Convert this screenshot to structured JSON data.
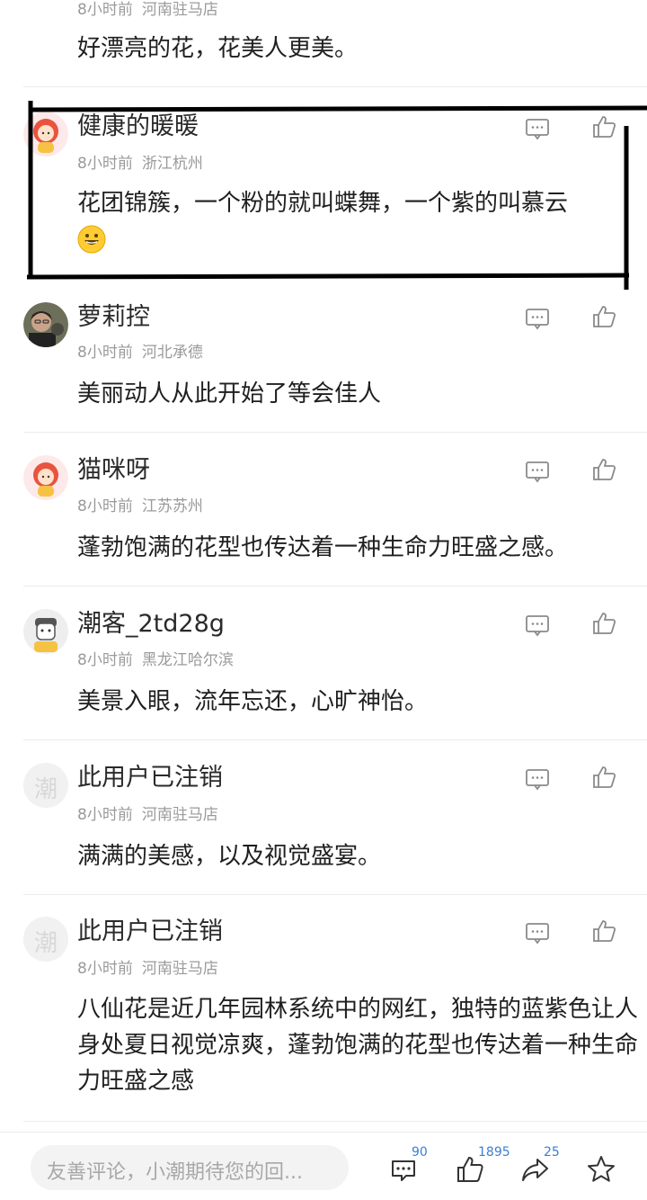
{
  "comments": [
    {
      "username": "",
      "time": "8小时前",
      "location": "河南驻马店",
      "text": "好漂亮的花，花美人更美。"
    },
    {
      "username": "健康的暖暖",
      "time": "8小时前",
      "location": "浙江杭州",
      "text": "花团锦簇，一个粉的就叫蝶舞，一个紫的叫慕云",
      "emoji": "😀"
    },
    {
      "username": "萝莉控",
      "time": "8小时前",
      "location": "河北承德",
      "text": "美丽动人从此开始了等会佳人"
    },
    {
      "username": "猫咪呀",
      "time": "8小时前",
      "location": "江苏苏州",
      "text": "蓬勃饱满的花型也传达着一种生命力旺盛之感。"
    },
    {
      "username": "潮客_2td28g",
      "time": "8小时前",
      "location": "黑龙江哈尔滨",
      "text": "美景入眼，流年忘还，心旷神怡。"
    },
    {
      "username": "此用户已注销",
      "time": "8小时前",
      "location": "河南驻马店",
      "text": "满满的美感，以及视觉盛宴。",
      "avatar_text": "潮"
    },
    {
      "username": "此用户已注销",
      "time": "8小时前",
      "location": "河南驻马店",
      "text": "八仙花是近几年园林系统中的网红，独特的蓝紫色让人身处夏日视觉凉爽，蓬勃饱满的花型也传达着一种生命力旺盛之感",
      "avatar_text": "潮"
    }
  ],
  "bottom_bar": {
    "input_placeholder": "友善评论，小潮期待您的回...",
    "comment_count": "90",
    "like_count": "1895",
    "share_count": "25"
  },
  "icons": {
    "reply": "comment-bubble-icon",
    "like": "thumbs-up-icon",
    "share": "share-arrow-icon",
    "favorite": "star-icon"
  },
  "colors": {
    "accent": "#3b7fd1",
    "meta": "#9a9a9a",
    "highlight": "#000000"
  }
}
